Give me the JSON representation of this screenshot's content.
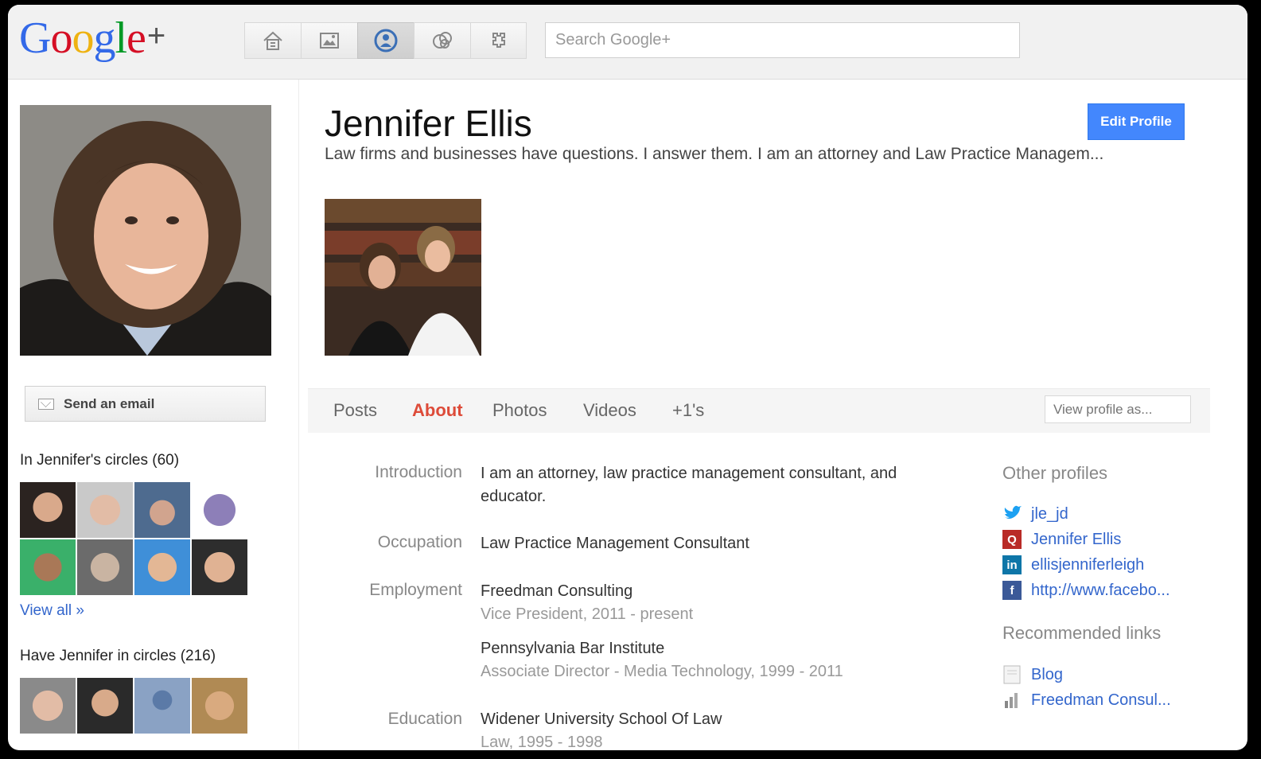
{
  "header": {
    "logo_text": "Google",
    "logo_plus": "+",
    "search_placeholder": "Search Google+",
    "nav_icons": [
      "home-icon",
      "photos-icon",
      "profile-icon",
      "circles-icon",
      "games-icon"
    ],
    "active_nav": "profile-icon"
  },
  "left": {
    "send_email": "Send an email",
    "in_circles_title": "In Jennifer's circles (60)",
    "view_all": "View all »",
    "have_in_circles_title": "Have Jennifer in circles (216)"
  },
  "profile": {
    "name": "Jennifer Ellis",
    "tagline": "Law firms and businesses have questions. I answer them. I am an attorney and Law Practice Managem...",
    "edit_button": "Edit Profile"
  },
  "tabs": {
    "items": [
      "Posts",
      "About",
      "Photos",
      "Videos",
      "+1's"
    ],
    "active": "About",
    "view_profile_as_placeholder": "View profile as..."
  },
  "about": {
    "introduction_label": "Introduction",
    "introduction_line1": "I am an attorney, law practice management consultant, and",
    "introduction_line2": "educator.",
    "occupation_label": "Occupation",
    "occupation": "Law Practice Management Consultant",
    "employment_label": "Employment",
    "employment": [
      {
        "org": "Freedman Consulting",
        "detail": "Vice President, 2011 - present"
      },
      {
        "org": "Pennsylvania Bar Institute",
        "detail": "Associate Director - Media Technology, 1999 - 2011"
      }
    ],
    "education_label": "Education",
    "education": [
      {
        "org": "Widener University School Of Law",
        "detail": "Law, 1995 - 1998"
      }
    ]
  },
  "sidebar": {
    "other_profiles_title": "Other profiles",
    "other_profiles": [
      {
        "icon": "twitter-icon",
        "label": "jle_jd",
        "color": "#1da1f2"
      },
      {
        "icon": "quora-icon",
        "label": "Jennifer Ellis",
        "color": "#b92b27"
      },
      {
        "icon": "linkedin-icon",
        "label": "ellisjenniferleigh",
        "color": "#0e76a8"
      },
      {
        "icon": "facebook-icon",
        "label": "http://www.facebo...",
        "color": "#3b5998"
      }
    ],
    "recommended_title": "Recommended links",
    "recommended": [
      {
        "icon": "page-icon",
        "label": "Blog"
      },
      {
        "icon": "site-favicon-icon",
        "label": "Freedman Consul..."
      }
    ]
  },
  "colors": {
    "accent_red": "#dd4b39",
    "link_blue": "#3366cc",
    "button_blue": "#4387fd"
  }
}
